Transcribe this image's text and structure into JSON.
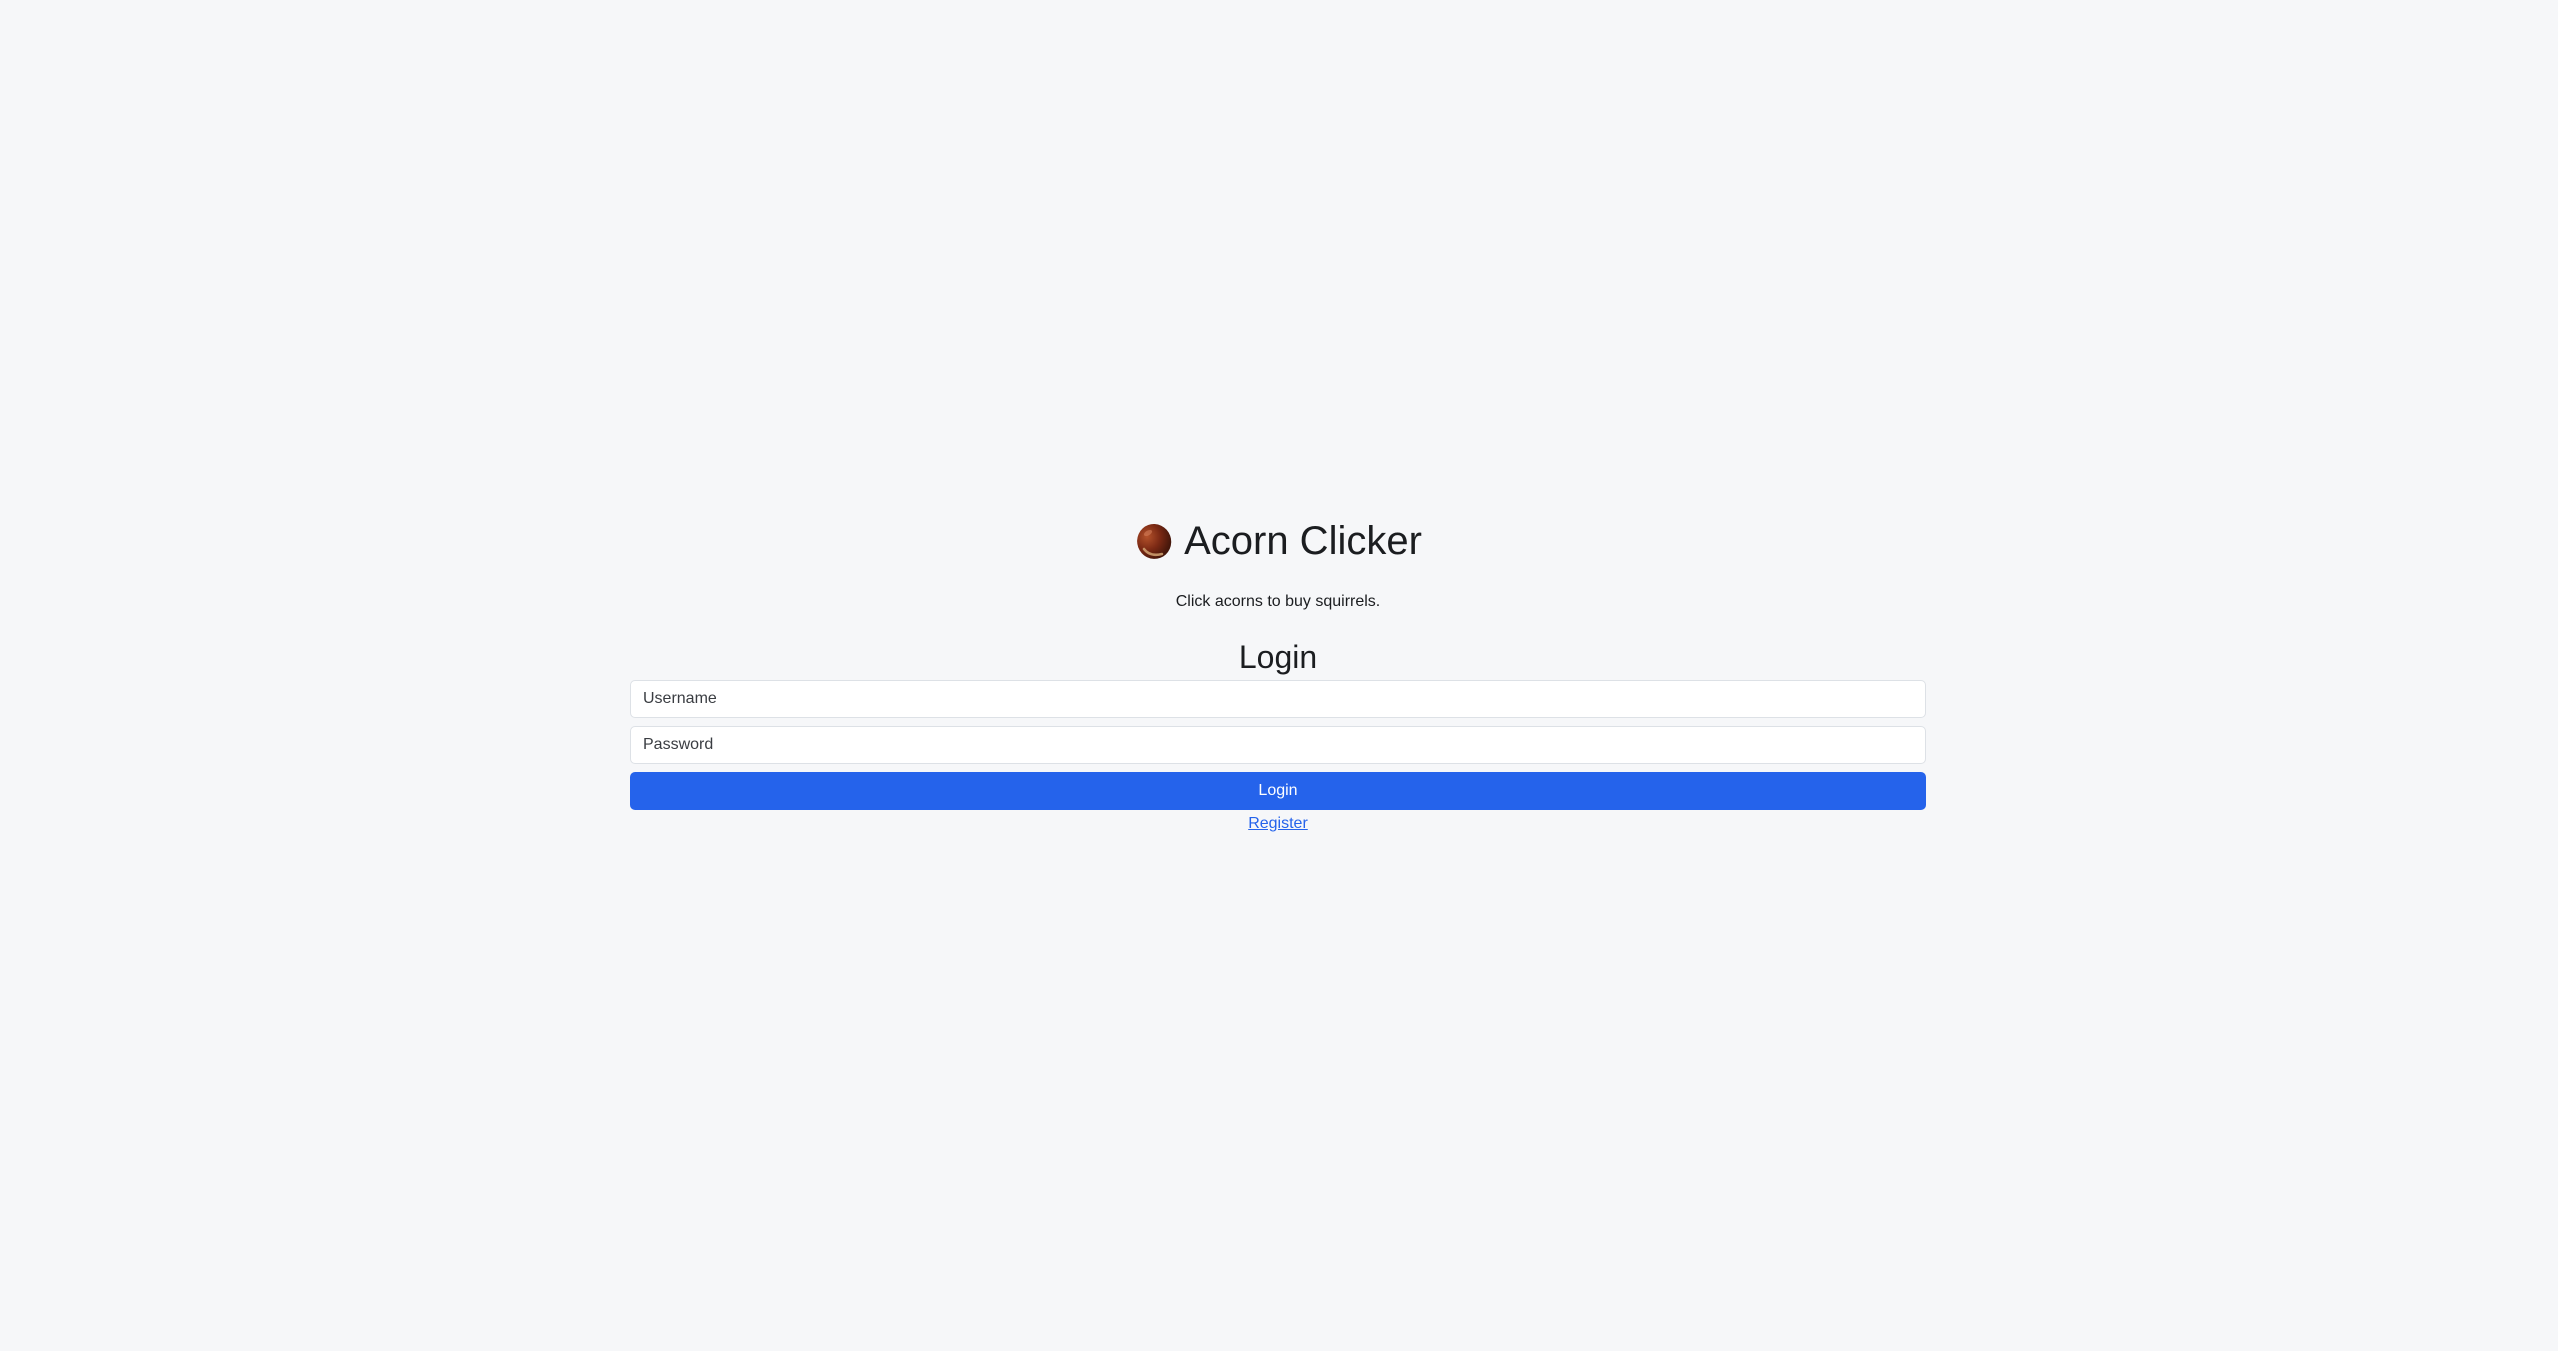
{
  "app": {
    "title": "Acorn Clicker",
    "tagline": "Click acorns to buy squirrels.",
    "logo_icon": "acorn-icon"
  },
  "login": {
    "heading": "Login",
    "username_placeholder": "Username",
    "password_placeholder": "Password",
    "submit_label": "Login",
    "register_link": "Register"
  },
  "colors": {
    "background": "#f6f7f9",
    "accent": "#2563eb",
    "text": "#1b1d20"
  }
}
